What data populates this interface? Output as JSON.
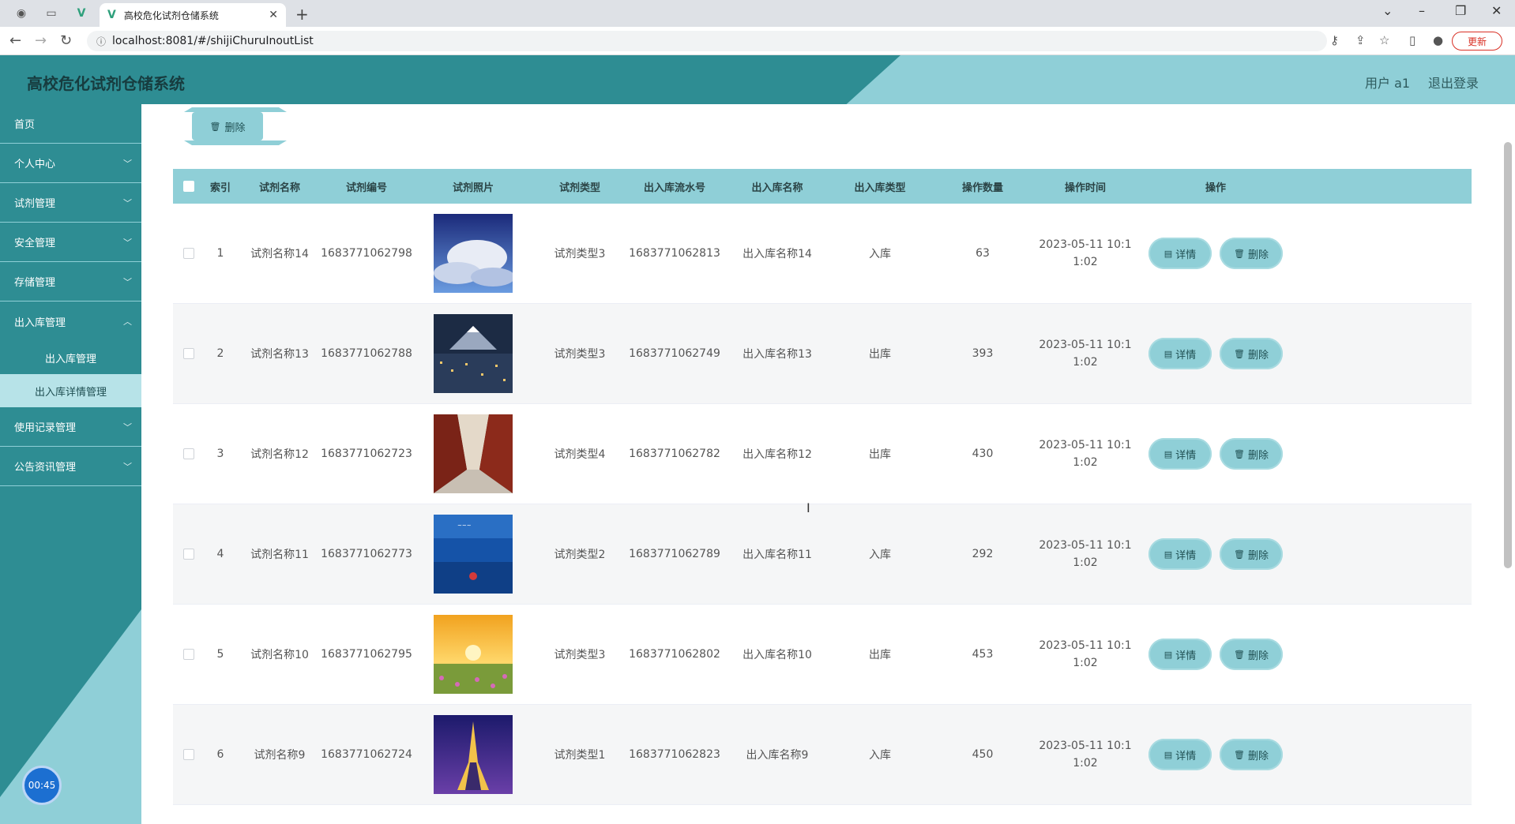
{
  "browser": {
    "tab_title": "高校危化试剂仓储系统",
    "url": "localhost:8081/#/shijiChuruInoutList",
    "update_label": "更新"
  },
  "header": {
    "title": "高校危化试剂仓储系统",
    "user": "用户 a1",
    "logout": "退出登录"
  },
  "sidebar": {
    "items": [
      {
        "label": "首页"
      },
      {
        "label": "个人中心"
      },
      {
        "label": "试剂管理"
      },
      {
        "label": "安全管理"
      },
      {
        "label": "存储管理"
      },
      {
        "label": "出入库管理"
      },
      {
        "label": "出入库管理"
      },
      {
        "label": "出入库详情管理"
      },
      {
        "label": "使用记录管理"
      },
      {
        "label": "公告资讯管理"
      }
    ],
    "timer": "00:45"
  },
  "toolbar": {
    "delete_label": "删除"
  },
  "table": {
    "headers": [
      "索引",
      "试剂名称",
      "试剂编号",
      "试剂照片",
      "试剂类型",
      "出入库流水号",
      "出入库名称",
      "出入库类型",
      "操作数量",
      "操作时间",
      "操作"
    ],
    "detail_label": "详情",
    "delete_label": "删除",
    "rows": [
      {
        "index": "1",
        "name": "试剂名称14",
        "code": "1683771062798",
        "type": "试剂类型3",
        "serial": "1683771062813",
        "io_name": "出入库名称14",
        "io_type": "入库",
        "qty": "63",
        "time1": "2023-05-11 10:1",
        "time2": "1:02",
        "photo": "sky-clouds"
      },
      {
        "index": "2",
        "name": "试剂名称13",
        "code": "1683771062788",
        "type": "试剂类型3",
        "serial": "1683771062749",
        "io_name": "出入库名称13",
        "io_type": "出库",
        "qty": "393",
        "time1": "2023-05-11 10:1",
        "time2": "1:02",
        "photo": "city-mountain"
      },
      {
        "index": "3",
        "name": "试剂名称12",
        "code": "1683771062723",
        "type": "试剂类型4",
        "serial": "1683771062782",
        "io_name": "出入库名称12",
        "io_type": "出库",
        "qty": "430",
        "time1": "2023-05-11 10:1",
        "time2": "1:02",
        "photo": "red-corridor"
      },
      {
        "index": "4",
        "name": "试剂名称11",
        "code": "1683771062773",
        "type": "试剂类型2",
        "serial": "1683771062789",
        "io_name": "出入库名称11",
        "io_type": "入库",
        "qty": "292",
        "time1": "2023-05-11 10:1",
        "time2": "1:02",
        "photo": "blue-sea"
      },
      {
        "index": "5",
        "name": "试剂名称10",
        "code": "1683771062795",
        "type": "试剂类型3",
        "serial": "1683771062802",
        "io_name": "出入库名称10",
        "io_type": "出库",
        "qty": "453",
        "time1": "2023-05-11 10:1",
        "time2": "1:02",
        "photo": "sunset-flowers"
      },
      {
        "index": "6",
        "name": "试剂名称9",
        "code": "1683771062724",
        "type": "试剂类型1",
        "serial": "1683771062823",
        "io_name": "出入库名称9",
        "io_type": "入库",
        "qty": "450",
        "time1": "2023-05-11 10:1",
        "time2": "1:02",
        "photo": "eiffel-night"
      }
    ]
  }
}
